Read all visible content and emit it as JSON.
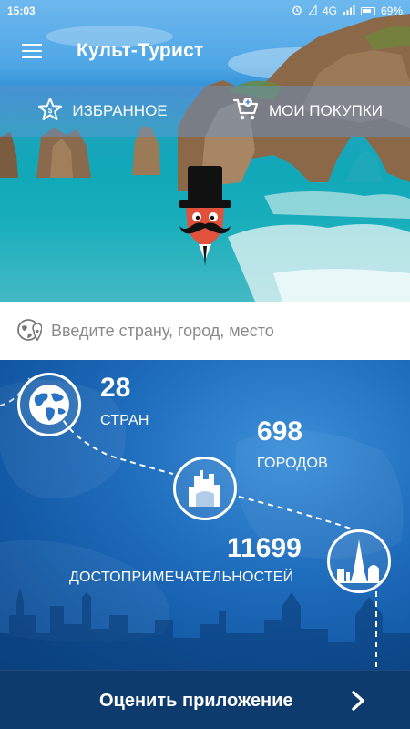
{
  "status_bar": {
    "time": "15:03",
    "network": "4G",
    "battery": "69%"
  },
  "app": {
    "title": "Культ-Турист"
  },
  "tabs": [
    {
      "label": "ИЗБРАННОЕ",
      "icon": "star-bookmark-icon"
    },
    {
      "label": "МОИ ПОКУПКИ",
      "icon": "shopping-cart-icon"
    }
  ],
  "search": {
    "placeholder": "Введите страну, город, место",
    "icon": "location-globe-icon"
  },
  "stats": [
    {
      "number": "28",
      "label": "СТРАН",
      "icon": "globe-icon"
    },
    {
      "number": "698",
      "label": "ГОРОДОВ",
      "icon": "city-icon"
    },
    {
      "number": "11699",
      "label": "ДОСТОПРИМЕЧАТЕЛЬНОСТЕЙ",
      "icon": "landmarks-icon"
    }
  ],
  "footer": {
    "rate_label": "Оценить приложение"
  },
  "colors": {
    "accent_dark": "#0e3b6e",
    "stats_bg": "#1f6dbd",
    "sea": "#0fa8b8"
  }
}
